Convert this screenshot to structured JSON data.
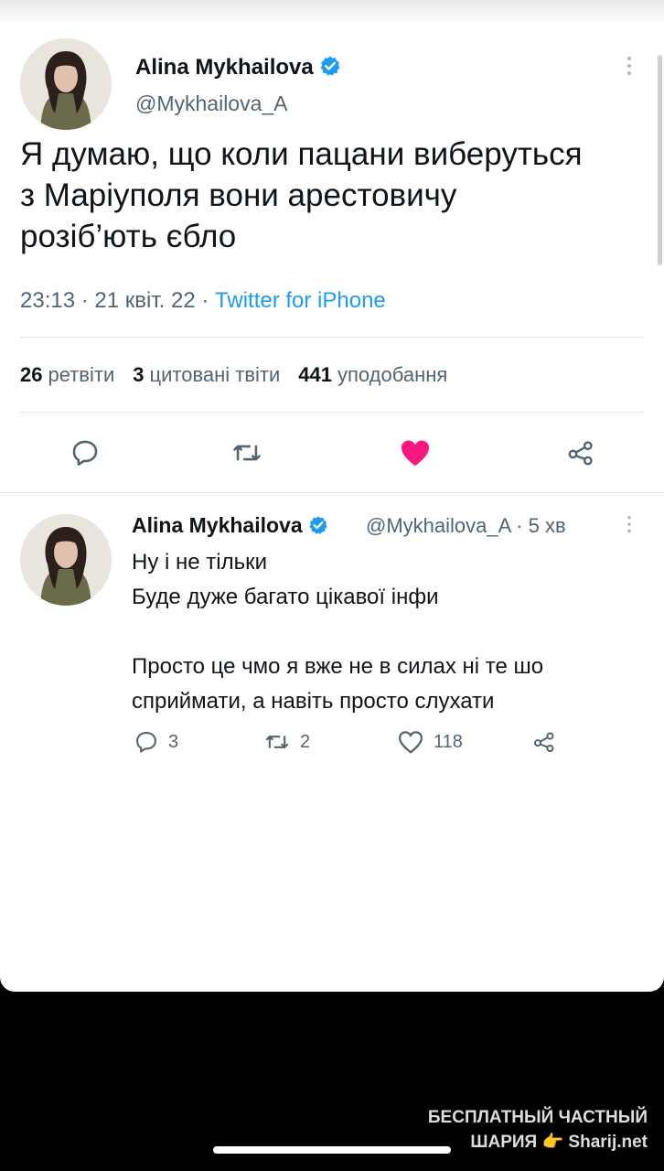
{
  "main_tweet": {
    "author_name": "Alina Mykhailova",
    "handle": "@Mykhailova_A",
    "text": "Я думаю, що коли пацани виберуться з Маріуполя вони арестовичу розіб’ють єбло",
    "time": "23:13 · 21 квіт. 22 · ",
    "source": "Twitter for iPhone",
    "stats": {
      "retweets_count": "26",
      "retweets_label": "ретвіти",
      "quotes_count": "3",
      "quotes_label": "цитовані твіти",
      "likes_count": "441",
      "likes_label": "уподобання"
    },
    "liked": true
  },
  "reply_tweet": {
    "author_name": "Alina Mykhailova",
    "handle_time": "@Mykhailova_A · 5 хв",
    "lines": [
      "Ну і не тільки",
      "Буде дуже багато цікавої інфи",
      "",
      "Просто це чмо я вже не в силах ні те шо",
      "сприймати, а навіть просто слухати"
    ],
    "replies": "3",
    "retweets": "2",
    "likes": "118"
  },
  "watermark": {
    "line1": "БЕСПЛАТНЫЙ ЧАСТНЫЙ",
    "line2": "ШАРИЯ 👉 Sharij.net"
  },
  "colors": {
    "accent": "#1d9bf0",
    "like": "#f91880",
    "text": "#0f1419",
    "muted": "#536471"
  },
  "icons": [
    "verified-badge-icon",
    "more-icon",
    "reply-icon",
    "retweet-icon",
    "heart-icon",
    "share-icon"
  ]
}
